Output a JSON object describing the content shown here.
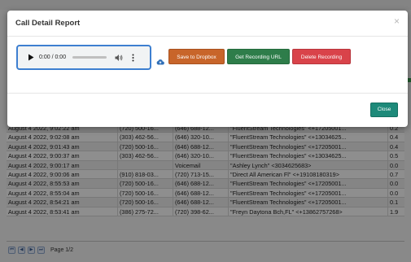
{
  "modal": {
    "title": "Call Detail Report",
    "close_glyph": "×",
    "player": {
      "time": "0:00 / 0:00",
      "play_icon": "play-icon",
      "volume_icon": "volume-icon",
      "more_icon": "more-vert-icon"
    },
    "cloud_icon": "cloud-upload-icon",
    "buttons": {
      "dropbox": "Save to Dropbox",
      "recording_url": "Get Recording URL",
      "delete": "Delete Recording",
      "close": "Close"
    },
    "colors": {
      "dropbox": "#c8652a",
      "recording_url": "#2e7d4a",
      "delete": "#d9434a",
      "close": "#1e8a7a"
    }
  },
  "table": {
    "rows": [
      [
        "August 4 2022, 9:02:22 am",
        "(720) 500-16...",
        "(646) 688-12...",
        "\"FluentStream Technologies\" <+17205001...",
        "0.2"
      ],
      [
        "August 4 2022, 9:02:08 am",
        "(303) 462-56...",
        "(646) 320-10...",
        "\"FluentStream Technologies\" <+13034625...",
        "0.4"
      ],
      [
        "August 4 2022, 9:01:43 am",
        "(720) 500-16...",
        "(646) 688-12...",
        "\"FluentStream Technologies\" <+17205001...",
        "0.4"
      ],
      [
        "August 4 2022, 9:00:37 am",
        "(303) 462-56...",
        "(646) 320-10...",
        "\"FluentStream Technologies\" <+13034625...",
        "0.5"
      ],
      [
        "August 4 2022, 9:00:17 am",
        "",
        "Voicemail",
        "\"Ashley Lynch\" <3034625683>",
        "0.0"
      ],
      [
        "August 4 2022, 9:00:06 am",
        "(910) 818-03...",
        "(720) 713-15...",
        "\"Direct All American Fl\" <+19108180319>",
        "0.7"
      ],
      [
        "August 4 2022, 8:55:53 am",
        "(720) 500-16...",
        "(646) 688-12...",
        "\"FluentStream Technologies\" <+17205001...",
        "0.0"
      ],
      [
        "August 4 2022, 8:55:04 am",
        "(720) 500-16...",
        "(646) 688-12...",
        "\"FluentStream Technologies\" <+17205001...",
        "0.0"
      ],
      [
        "August 4 2022, 8:54:21 am",
        "(720) 500-16...",
        "(646) 688-12...",
        "\"FluentStream Technologies\" <+17205001...",
        "0.1"
      ],
      [
        "August 4 2022, 8:53:41 am",
        "(386) 275-72...",
        "(720) 398-62...",
        "\"Freyn Daytona Bch,FL\" <+13862757268>",
        "1.9"
      ]
    ]
  },
  "pager": {
    "label": "Page 1/2",
    "first": "⏮",
    "prev": "◀",
    "next": "▶",
    "last": "⏭"
  }
}
